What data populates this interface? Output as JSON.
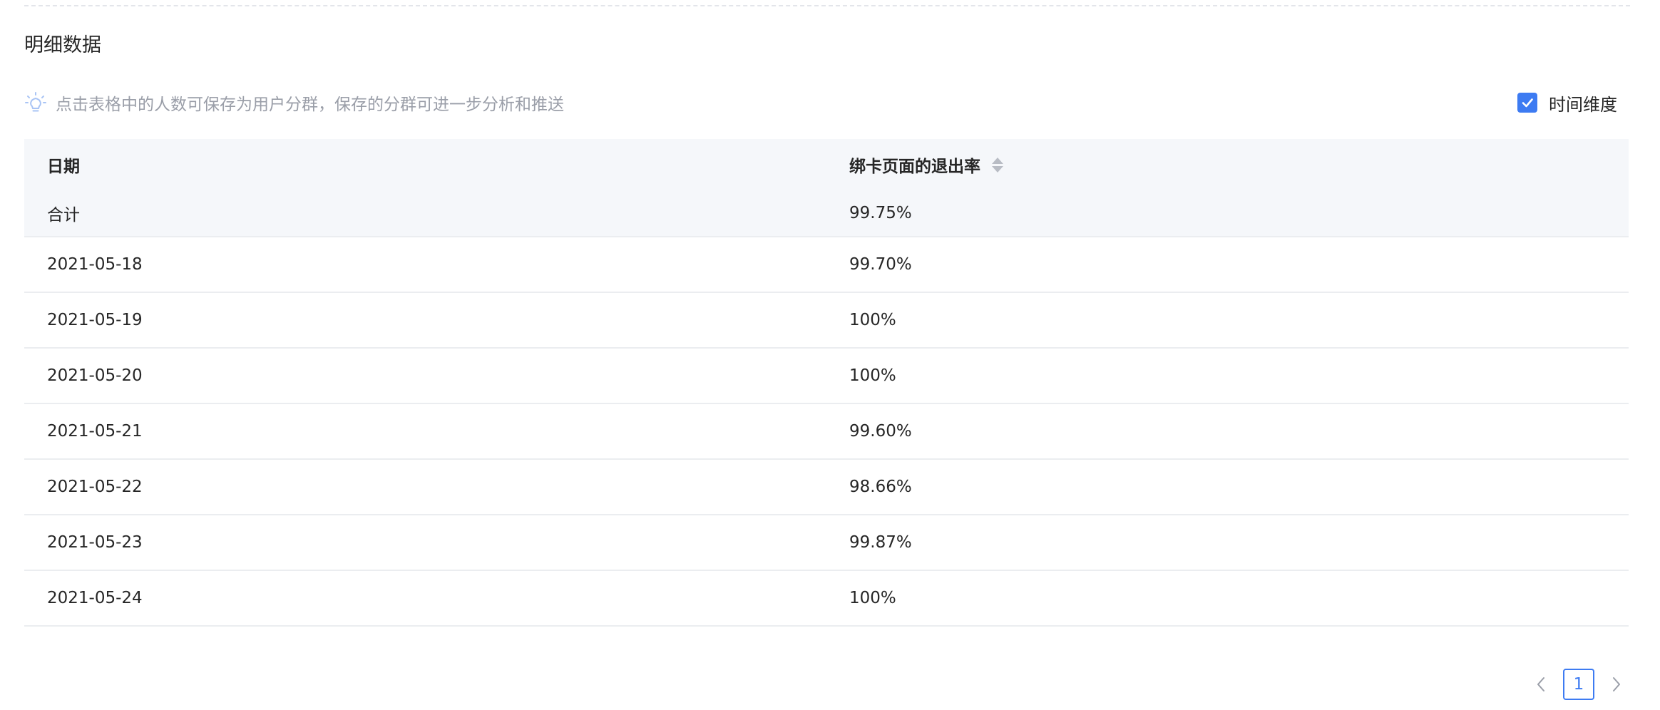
{
  "section": {
    "title": "明细数据",
    "tip": "点击表格中的人数可保存为用户分群，保存的分群可进一步分析和推送"
  },
  "options": {
    "time_dimension_label": "时间维度",
    "time_dimension_checked": true
  },
  "table": {
    "columns": [
      "日期",
      "绑卡页面的退出率"
    ],
    "total": {
      "label": "合计",
      "value": "99.75%"
    },
    "rows": [
      {
        "date": "2021-05-18",
        "value": "99.70%"
      },
      {
        "date": "2021-05-19",
        "value": "100%"
      },
      {
        "date": "2021-05-20",
        "value": "100%"
      },
      {
        "date": "2021-05-21",
        "value": "99.60%"
      },
      {
        "date": "2021-05-22",
        "value": "98.66%"
      },
      {
        "date": "2021-05-23",
        "value": "99.87%"
      },
      {
        "date": "2021-05-24",
        "value": "100%"
      }
    ]
  },
  "pagination": {
    "current_page": "1",
    "prev_icon": "chevron-left-icon",
    "next_icon": "chevron-right-icon"
  },
  "colors": {
    "accent": "#3d7bf2",
    "header_bg": "#f5f7fa",
    "muted_text": "#9a9ea8"
  }
}
